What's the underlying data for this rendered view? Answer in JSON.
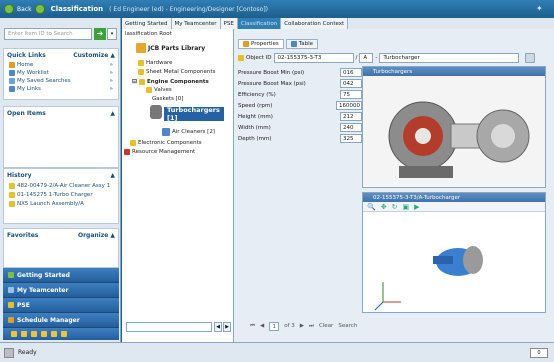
{
  "titlebar": {
    "back": "Back",
    "app": "Classification",
    "context": "( Ed Engineer (ed) - Engineering/Designer [Contoso])"
  },
  "left": {
    "search_placeholder": "Enter Item ID to Search",
    "quick_links": {
      "title": "Quick Links",
      "action": "Customize",
      "items": [
        "Home",
        "My Worklist",
        "My Saved Searches",
        "My Links"
      ]
    },
    "open_items": {
      "title": "Open Items"
    },
    "history": {
      "title": "History",
      "items": [
        "482-00479-2/A-Air Cleaner Assy 1",
        "01-145275 1-Turbo Charger",
        "NX5 Launch Assembly/A"
      ]
    },
    "favorites": {
      "title": "Favorites",
      "action": "Organize"
    },
    "nav": [
      "Getting Started",
      "My Teamcenter",
      "PSE",
      "Schedule Manager"
    ]
  },
  "tabs": [
    "Getting Started",
    "My Teamcenter",
    "PSE",
    "Classification",
    "Collaboration Context"
  ],
  "tree": {
    "root": "lassification Root",
    "library": "JCB Parts Library",
    "nodes": [
      "Hardware",
      "Sheet Metal Components",
      "Engine Components",
      "Valves",
      "Gaskets [0]",
      "Turbochargers [1]",
      "Air Cleaners [2]",
      "Electronic Components",
      "Resource Management"
    ]
  },
  "properties": {
    "tab_properties": "Properties",
    "tab_table": "Table",
    "object_id_label": "Object ID",
    "object_id": "02-155375-3-T3",
    "rev": "A",
    "name": "Turbocharger",
    "rows": [
      {
        "label": "Pressure Boost Min (psi)",
        "value": "016"
      },
      {
        "label": "Pressure Boost Max (psi)",
        "value": "042"
      },
      {
        "label": "Efficiency (%)",
        "value": "75"
      },
      {
        "label": "Speed (rpm)",
        "value": "160000"
      },
      {
        "label": "Height (mm)",
        "value": "212"
      },
      {
        "label": "Width (mm)",
        "value": "240"
      },
      {
        "label": "Depth (mm)",
        "value": "325"
      }
    ]
  },
  "image_panel": {
    "title": "Turbochargers"
  },
  "viz_panel": {
    "title": "02-155375-3-T3/A-Turbocharger"
  },
  "pager": {
    "page": "1",
    "of": "of 3",
    "clear": "Clear",
    "search": "Search"
  },
  "status": {
    "text": "Ready"
  }
}
